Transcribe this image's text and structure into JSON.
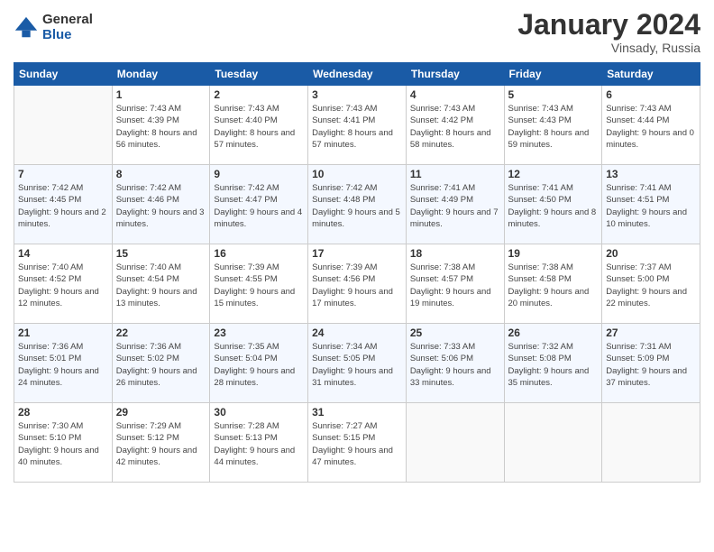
{
  "logo": {
    "general": "General",
    "blue": "Blue"
  },
  "header": {
    "month": "January 2024",
    "location": "Vinsady, Russia"
  },
  "weekdays": [
    "Sunday",
    "Monday",
    "Tuesday",
    "Wednesday",
    "Thursday",
    "Friday",
    "Saturday"
  ],
  "weeks": [
    [
      {
        "day": "",
        "sunrise": "",
        "sunset": "",
        "daylight": ""
      },
      {
        "day": "1",
        "sunrise": "Sunrise: 7:43 AM",
        "sunset": "Sunset: 4:39 PM",
        "daylight": "Daylight: 8 hours and 56 minutes."
      },
      {
        "day": "2",
        "sunrise": "Sunrise: 7:43 AM",
        "sunset": "Sunset: 4:40 PM",
        "daylight": "Daylight: 8 hours and 57 minutes."
      },
      {
        "day": "3",
        "sunrise": "Sunrise: 7:43 AM",
        "sunset": "Sunset: 4:41 PM",
        "daylight": "Daylight: 8 hours and 57 minutes."
      },
      {
        "day": "4",
        "sunrise": "Sunrise: 7:43 AM",
        "sunset": "Sunset: 4:42 PM",
        "daylight": "Daylight: 8 hours and 58 minutes."
      },
      {
        "day": "5",
        "sunrise": "Sunrise: 7:43 AM",
        "sunset": "Sunset: 4:43 PM",
        "daylight": "Daylight: 8 hours and 59 minutes."
      },
      {
        "day": "6",
        "sunrise": "Sunrise: 7:43 AM",
        "sunset": "Sunset: 4:44 PM",
        "daylight": "Daylight: 9 hours and 0 minutes."
      }
    ],
    [
      {
        "day": "7",
        "sunrise": "Sunrise: 7:42 AM",
        "sunset": "Sunset: 4:45 PM",
        "daylight": "Daylight: 9 hours and 2 minutes."
      },
      {
        "day": "8",
        "sunrise": "Sunrise: 7:42 AM",
        "sunset": "Sunset: 4:46 PM",
        "daylight": "Daylight: 9 hours and 3 minutes."
      },
      {
        "day": "9",
        "sunrise": "Sunrise: 7:42 AM",
        "sunset": "Sunset: 4:47 PM",
        "daylight": "Daylight: 9 hours and 4 minutes."
      },
      {
        "day": "10",
        "sunrise": "Sunrise: 7:42 AM",
        "sunset": "Sunset: 4:48 PM",
        "daylight": "Daylight: 9 hours and 5 minutes."
      },
      {
        "day": "11",
        "sunrise": "Sunrise: 7:41 AM",
        "sunset": "Sunset: 4:49 PM",
        "daylight": "Daylight: 9 hours and 7 minutes."
      },
      {
        "day": "12",
        "sunrise": "Sunrise: 7:41 AM",
        "sunset": "Sunset: 4:50 PM",
        "daylight": "Daylight: 9 hours and 8 minutes."
      },
      {
        "day": "13",
        "sunrise": "Sunrise: 7:41 AM",
        "sunset": "Sunset: 4:51 PM",
        "daylight": "Daylight: 9 hours and 10 minutes."
      }
    ],
    [
      {
        "day": "14",
        "sunrise": "Sunrise: 7:40 AM",
        "sunset": "Sunset: 4:52 PM",
        "daylight": "Daylight: 9 hours and 12 minutes."
      },
      {
        "day": "15",
        "sunrise": "Sunrise: 7:40 AM",
        "sunset": "Sunset: 4:54 PM",
        "daylight": "Daylight: 9 hours and 13 minutes."
      },
      {
        "day": "16",
        "sunrise": "Sunrise: 7:39 AM",
        "sunset": "Sunset: 4:55 PM",
        "daylight": "Daylight: 9 hours and 15 minutes."
      },
      {
        "day": "17",
        "sunrise": "Sunrise: 7:39 AM",
        "sunset": "Sunset: 4:56 PM",
        "daylight": "Daylight: 9 hours and 17 minutes."
      },
      {
        "day": "18",
        "sunrise": "Sunrise: 7:38 AM",
        "sunset": "Sunset: 4:57 PM",
        "daylight": "Daylight: 9 hours and 19 minutes."
      },
      {
        "day": "19",
        "sunrise": "Sunrise: 7:38 AM",
        "sunset": "Sunset: 4:58 PM",
        "daylight": "Daylight: 9 hours and 20 minutes."
      },
      {
        "day": "20",
        "sunrise": "Sunrise: 7:37 AM",
        "sunset": "Sunset: 5:00 PM",
        "daylight": "Daylight: 9 hours and 22 minutes."
      }
    ],
    [
      {
        "day": "21",
        "sunrise": "Sunrise: 7:36 AM",
        "sunset": "Sunset: 5:01 PM",
        "daylight": "Daylight: 9 hours and 24 minutes."
      },
      {
        "day": "22",
        "sunrise": "Sunrise: 7:36 AM",
        "sunset": "Sunset: 5:02 PM",
        "daylight": "Daylight: 9 hours and 26 minutes."
      },
      {
        "day": "23",
        "sunrise": "Sunrise: 7:35 AM",
        "sunset": "Sunset: 5:04 PM",
        "daylight": "Daylight: 9 hours and 28 minutes."
      },
      {
        "day": "24",
        "sunrise": "Sunrise: 7:34 AM",
        "sunset": "Sunset: 5:05 PM",
        "daylight": "Daylight: 9 hours and 31 minutes."
      },
      {
        "day": "25",
        "sunrise": "Sunrise: 7:33 AM",
        "sunset": "Sunset: 5:06 PM",
        "daylight": "Daylight: 9 hours and 33 minutes."
      },
      {
        "day": "26",
        "sunrise": "Sunrise: 7:32 AM",
        "sunset": "Sunset: 5:08 PM",
        "daylight": "Daylight: 9 hours and 35 minutes."
      },
      {
        "day": "27",
        "sunrise": "Sunrise: 7:31 AM",
        "sunset": "Sunset: 5:09 PM",
        "daylight": "Daylight: 9 hours and 37 minutes."
      }
    ],
    [
      {
        "day": "28",
        "sunrise": "Sunrise: 7:30 AM",
        "sunset": "Sunset: 5:10 PM",
        "daylight": "Daylight: 9 hours and 40 minutes."
      },
      {
        "day": "29",
        "sunrise": "Sunrise: 7:29 AM",
        "sunset": "Sunset: 5:12 PM",
        "daylight": "Daylight: 9 hours and 42 minutes."
      },
      {
        "day": "30",
        "sunrise": "Sunrise: 7:28 AM",
        "sunset": "Sunset: 5:13 PM",
        "daylight": "Daylight: 9 hours and 44 minutes."
      },
      {
        "day": "31",
        "sunrise": "Sunrise: 7:27 AM",
        "sunset": "Sunset: 5:15 PM",
        "daylight": "Daylight: 9 hours and 47 minutes."
      },
      {
        "day": "",
        "sunrise": "",
        "sunset": "",
        "daylight": ""
      },
      {
        "day": "",
        "sunrise": "",
        "sunset": "",
        "daylight": ""
      },
      {
        "day": "",
        "sunrise": "",
        "sunset": "",
        "daylight": ""
      }
    ]
  ]
}
